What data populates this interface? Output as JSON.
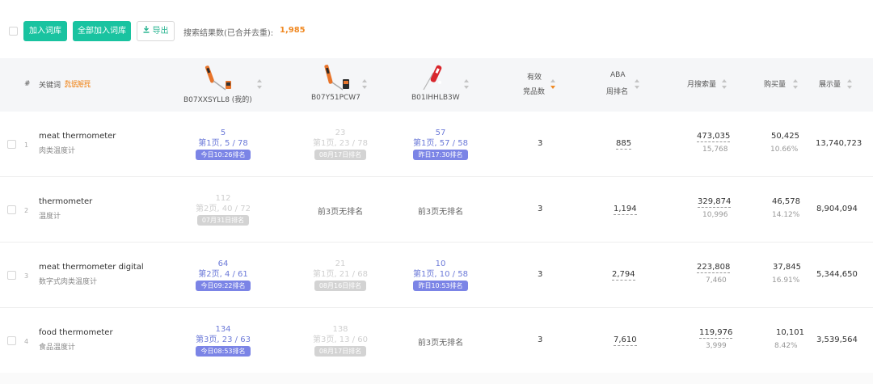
{
  "toolbar": {
    "add_label": "加入词库",
    "add_all_label": "全部加入词库",
    "export_label": "导出",
    "export_icon": "download-icon",
    "result_label": "搜索结果数(已合并去重):",
    "result_count": "1,985"
  },
  "colors": {
    "accent": "#19c3a0",
    "orange": "#f08a24",
    "rank_blue": "#6b79d8",
    "badge_blue": "#7b84e6",
    "muted": "#cfcfcf"
  },
  "header": {
    "index": "#",
    "keyword": "关键词",
    "explain": "数据解释",
    "asins": [
      {
        "label": "B07XXSYLL8 (我的)",
        "image": "orange-probe-thermometer"
      },
      {
        "label": "B07Y51PCW7",
        "image": "orange-probe-thermometer"
      },
      {
        "label": "B01IHHLB3W",
        "image": "red-probe-thermometer"
      }
    ],
    "competitors_l1": "有效",
    "competitors_l2": "竞品数",
    "aba_l1": "ABA",
    "aba_l2": "周排名",
    "monthly_search": "月搜索量",
    "purchases": "购买量",
    "impressions": "展示量"
  },
  "rows": [
    {
      "index": "1",
      "keyword": "meat thermometer",
      "keyword_cn": "肉类温度计",
      "ranks": [
        {
          "num": "5",
          "page": "第1页, 5 / 78",
          "badge": "今日10:26排名",
          "active": true
        },
        {
          "num": "23",
          "page": "第1页, 23 / 78",
          "badge": "08月17日排名",
          "active": false
        },
        {
          "num": "57",
          "page": "第1页, 57 / 58",
          "badge": "昨日17:30排名",
          "active": true
        }
      ],
      "competitors": "3",
      "aba": "885",
      "monthly": "473,035",
      "monthly_sub": "15,768",
      "purchases": "50,425",
      "purchase_rate": "10.66%",
      "impressions": "13,740,723"
    },
    {
      "index": "2",
      "keyword": "thermometer",
      "keyword_cn": "温度计",
      "ranks": [
        {
          "num": "112",
          "page": "第2页, 40 / 72",
          "badge": "07月31日排名",
          "active": false
        },
        {
          "norank": "前3页无排名"
        },
        {
          "norank": "前3页无排名"
        }
      ],
      "competitors": "3",
      "aba": "1,194",
      "monthly": "329,874",
      "monthly_sub": "10,996",
      "purchases": "46,578",
      "purchase_rate": "14.12%",
      "impressions": "8,904,094"
    },
    {
      "index": "3",
      "keyword": "meat thermometer digital",
      "keyword_cn": "数字式肉类温度计",
      "ranks": [
        {
          "num": "64",
          "page": "第2页, 4 / 61",
          "badge": "今日09:22排名",
          "active": true
        },
        {
          "num": "21",
          "page": "第1页, 21 / 68",
          "badge": "08月16日排名",
          "active": false
        },
        {
          "num": "10",
          "page": "第1页, 10 / 58",
          "badge": "昨日10:53排名",
          "active": true
        }
      ],
      "competitors": "3",
      "aba": "2,794",
      "monthly": "223,808",
      "monthly_sub": "7,460",
      "purchases": "37,845",
      "purchase_rate": "16.91%",
      "impressions": "5,344,650"
    },
    {
      "index": "4",
      "keyword": "food thermometer",
      "keyword_cn": "食品温度计",
      "ranks": [
        {
          "num": "134",
          "page": "第3页, 23 / 63",
          "badge": "今日08:53排名",
          "active": true
        },
        {
          "num": "138",
          "page": "第3页, 13 / 60",
          "badge": "08月17日排名",
          "active": false
        },
        {
          "norank": "前3页无排名"
        }
      ],
      "competitors": "3",
      "aba": "7,610",
      "monthly": "119,976",
      "monthly_sub": "3,999",
      "purchases": "10,101",
      "purchase_rate": "8.42%",
      "impressions": "3,539,564"
    }
  ]
}
